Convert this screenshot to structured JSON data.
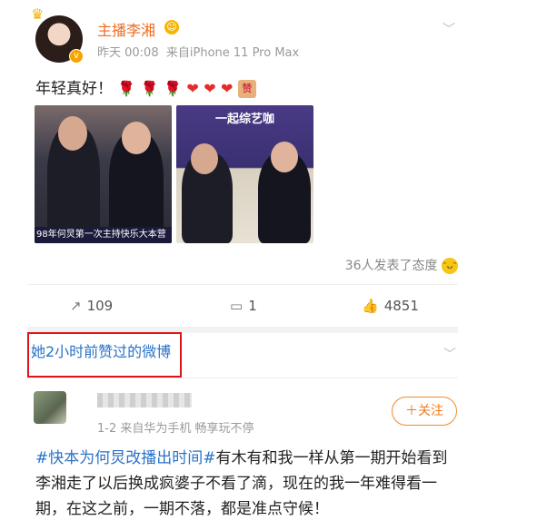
{
  "post": {
    "username": "主播李湘",
    "time": "昨天 00:08",
    "source": "来自iPhone 11 Pro Max",
    "text": "年轻真好！",
    "emojis": [
      "rose",
      "rose",
      "rose",
      "heart",
      "heart",
      "heart",
      "zan-stamp"
    ],
    "images": [
      {
        "caption": "98年何炅第一次主持快乐大本营"
      },
      {
        "caption": "一起综艺咖"
      }
    ],
    "reactions_text": "36人发表了态度",
    "actions": {
      "repost_count": "109",
      "comment_count": "1",
      "like_count": "4851"
    }
  },
  "liked_section": {
    "label": "她2小时前赞过的微博"
  },
  "liked_post": {
    "meta": "1-2  来自华为手机 畅享玩不停",
    "follow_label": "＋关注",
    "topic": "#快本为何炅改播出时间#",
    "text": "有木有和我一样从第一期开始看到李湘走了以后换成疯婆子不看了滴，现在的我一年难得看一期，在这之前，一期不落，都是准点守候！"
  },
  "colors": {
    "username": "#f06a18",
    "link_blue": "#2a72c8",
    "highlight_box": "#e0131a",
    "follow_orange": "#f07a18"
  }
}
